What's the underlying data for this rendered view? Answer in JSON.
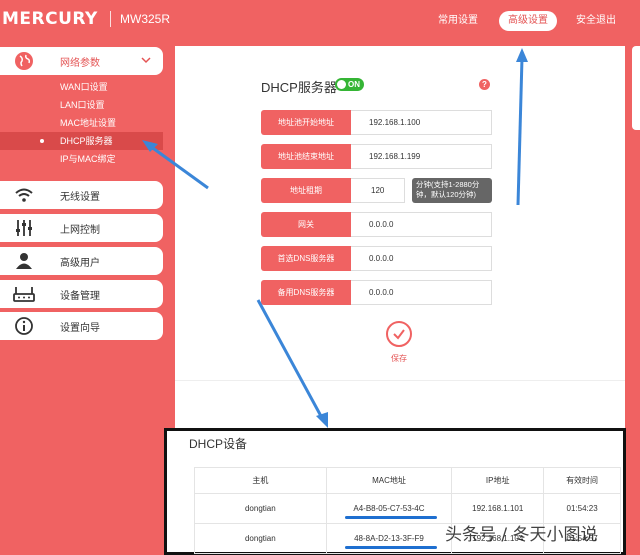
{
  "header": {
    "logo": "MERCURY",
    "model": "MW325R",
    "nav": {
      "common": "常用设置",
      "advanced": "高级设置",
      "logout": "安全退出"
    }
  },
  "sidebar": {
    "network": {
      "label": "网络参数",
      "icon": "globe-icon",
      "sub": [
        "WAN口设置",
        "LAN口设置",
        "MAC地址设置",
        "DHCP服务器",
        "IP与MAC绑定"
      ],
      "active_index": 3
    },
    "items": [
      {
        "label": "无线设置",
        "icon": "wifi-icon"
      },
      {
        "label": "上网控制",
        "icon": "sliders-icon"
      },
      {
        "label": "高级用户",
        "icon": "user-icon"
      },
      {
        "label": "设备管理",
        "icon": "router-icon"
      },
      {
        "label": "设置向导",
        "icon": "info-icon"
      }
    ]
  },
  "form": {
    "title": "DHCP服务器",
    "toggle": "ON",
    "help": "?",
    "fields": [
      {
        "label": "地址池开始地址",
        "value": "192.168.1.100"
      },
      {
        "label": "地址池结束地址",
        "value": "192.168.1.199"
      },
      {
        "label": "地址租期",
        "value": "120"
      },
      {
        "label": "网关",
        "value": "0.0.0.0"
      },
      {
        "label": "首选DNS服务器",
        "value": "0.0.0.0"
      },
      {
        "label": "备用DNS服务器",
        "value": "0.0.0.0"
      }
    ],
    "lease_tip": "分钟(支持1-2880分钟，默认120分钟)",
    "save": "保存"
  },
  "devices": {
    "title": "DHCP设备",
    "columns": [
      "主机",
      "MAC地址",
      "IP地址",
      "有效时间"
    ],
    "rows": [
      [
        "dongtian",
        "A4-B8-05-C7-53-4C",
        "192.168.1.101",
        "01:54:23"
      ],
      [
        "dongtian",
        "48-8A-D2-13-3F-F9",
        "192.168.1.104",
        "01:54:57"
      ]
    ]
  },
  "watermark": "头条号 / 冬天小图说",
  "colors": {
    "brand": "#f06262",
    "active": "#d94a4a",
    "toggle_on": "#35b535",
    "annotation": "#1e6fd0"
  }
}
